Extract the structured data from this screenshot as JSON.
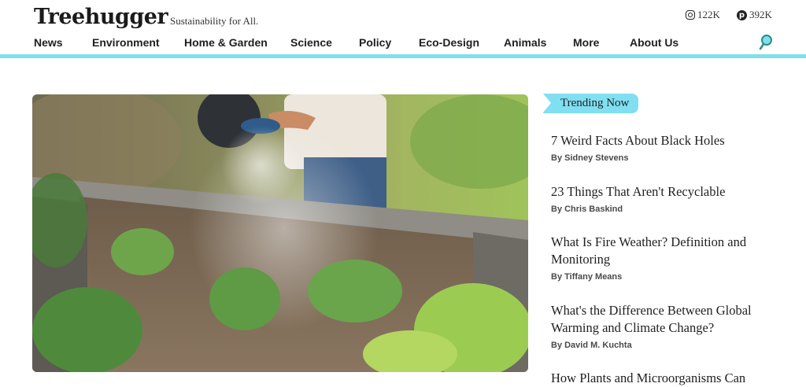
{
  "header": {
    "logo": "Treehugger",
    "tagline": "Sustainability for All.",
    "social": {
      "instagram_count": "122K",
      "pinterest_count": "392K"
    }
  },
  "nav": {
    "items": [
      "News",
      "Environment",
      "Home & Garden",
      "Science",
      "Policy",
      "Eco-Design",
      "Animals",
      "More",
      "About Us"
    ]
  },
  "hero": {
    "image": "watering-can-over-raised-garden-bed"
  },
  "trending": {
    "label": "Trending Now",
    "articles": [
      {
        "title": "7 Weird Facts About Black Holes",
        "author": "By Sidney Stevens"
      },
      {
        "title": "23 Things That Aren't Recyclable",
        "author": "By Chris Baskind"
      },
      {
        "title": "What Is Fire Weather? Definition and Monitoring",
        "author": "By Tiffany Means"
      },
      {
        "title": "What's the Difference Between Global Warming and Climate Change?",
        "author": "By David M. Kuchta"
      },
      {
        "title": "How Plants and Microorganisms Can",
        "author": ""
      }
    ]
  },
  "colors": {
    "accent": "#7fe0ec",
    "text": "#1f1f1f"
  }
}
